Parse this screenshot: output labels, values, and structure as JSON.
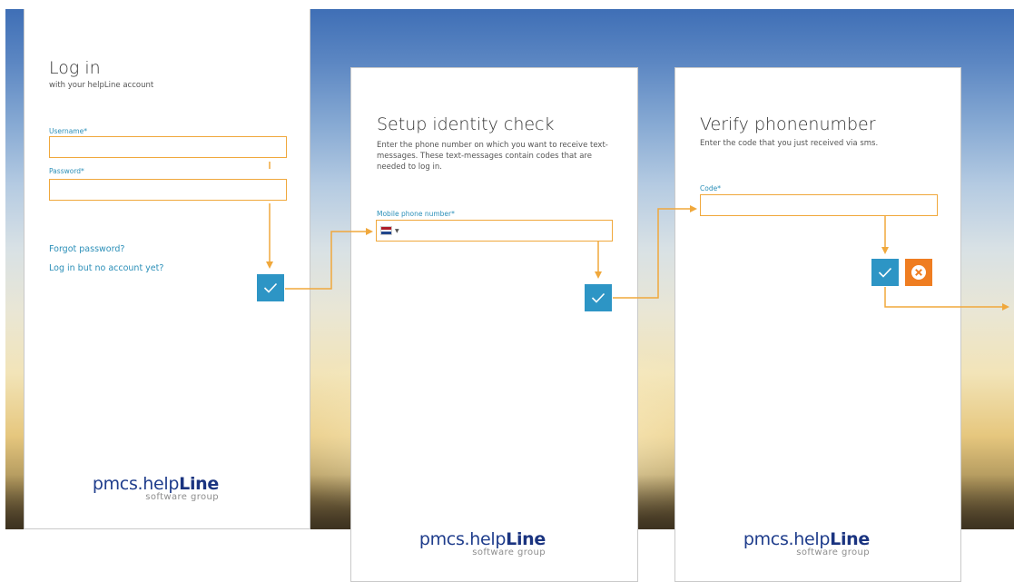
{
  "login": {
    "title": "Log in",
    "subtitle": "with your helpLine account",
    "username_label": "Username*",
    "username_value": "",
    "password_label": "Password*",
    "password_value": "",
    "forgot_password": "Forgot password?",
    "no_account": "Log in but no account yet?"
  },
  "setup": {
    "title": "Setup identity check",
    "description": "Enter the phone number on which you want to receive text-messages. These text-messages contain codes that are needed to log in.",
    "phone_label": "Mobile phone number*",
    "phone_value": "",
    "country_flag": "netherlands-flag"
  },
  "verify": {
    "title": "Verify phonenumber",
    "description": "Enter the code that you just received via sms.",
    "code_label": "Code*",
    "code_value": ""
  },
  "brand": {
    "name_regular": "pmcs.help",
    "name_bold": "Line",
    "tagline": "software group"
  },
  "colors": {
    "accent_blue": "#2d95c5",
    "accent_orange": "#ef7d21",
    "flow_arrow": "#f0a83c",
    "link": "#2b8fb8",
    "brand_navy": "#1b3480"
  },
  "icons": {
    "confirm": "check-icon",
    "cancel": "close-circle-icon"
  }
}
